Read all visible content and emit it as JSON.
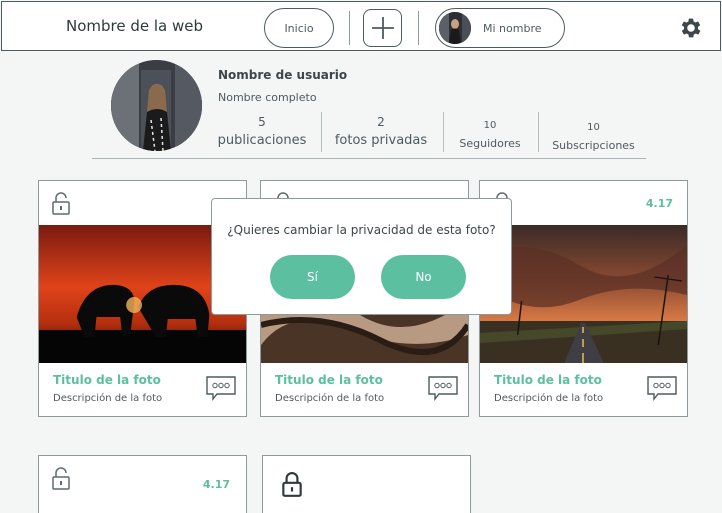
{
  "header": {
    "site_name": "Nombre de la web",
    "home_label": "Inicio",
    "user_label": "Mi nombre",
    "icons": [
      "plus-icon",
      "gear-icon"
    ]
  },
  "profile": {
    "username": "Nombre de usuario",
    "fullname": "Nombre completo",
    "stats": [
      {
        "value": "5",
        "label": "publicaciones"
      },
      {
        "value": "2",
        "label": "fotos privadas"
      },
      {
        "value": "10",
        "label": "Seguidores"
      },
      {
        "value": "10",
        "label": "Subscripciones"
      }
    ]
  },
  "cards": [
    {
      "title": "Titulo de la foto",
      "description": "Descripción de la foto"
    },
    {
      "title": "Titulo de la foto",
      "description": "Descripción de la foto"
    },
    {
      "title": "Titulo de la foto",
      "description": "Descripción de la foto",
      "rating": "4.17"
    },
    {
      "rating": "4.17"
    },
    {}
  ],
  "modal": {
    "question": "¿Quieres cambiar la privacidad de esta foto?",
    "yes_label": "Sí",
    "no_label": "No"
  },
  "colors": {
    "accent": "#5cc0a0",
    "border": "#4d5b5f"
  }
}
